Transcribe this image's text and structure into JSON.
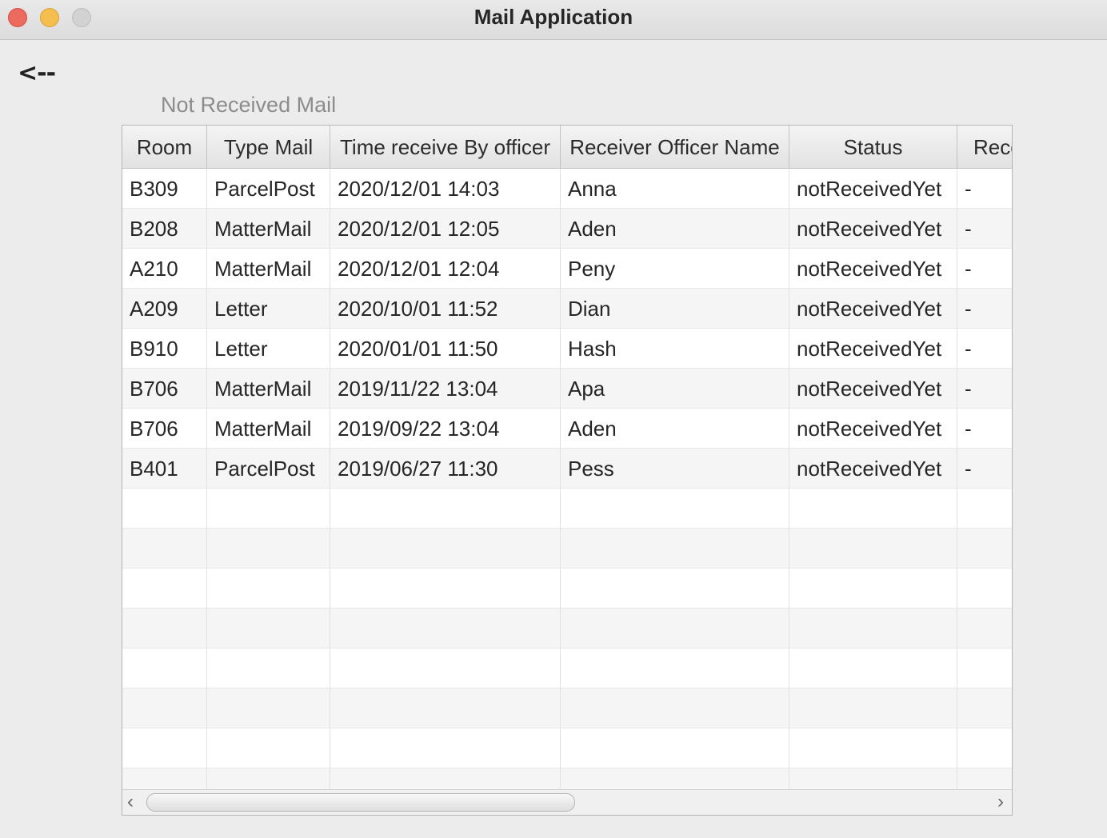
{
  "window": {
    "title": "Mail Application"
  },
  "back_label": "<--",
  "heading": "Not Received Mail",
  "table": {
    "columns": [
      "Room",
      "Type Mail",
      "Time receive By officer",
      "Receiver Officer Name",
      "Status",
      "Rece"
    ],
    "rows": [
      [
        "B309",
        "ParcelPost",
        "2020/12/01 14:03",
        "Anna",
        "notReceivedYet",
        "-"
      ],
      [
        "B208",
        "MatterMail",
        "2020/12/01 12:05",
        "Aden",
        "notReceivedYet",
        "-"
      ],
      [
        "A210",
        "MatterMail",
        "2020/12/01 12:04",
        "Peny",
        "notReceivedYet",
        "-"
      ],
      [
        "A209",
        "Letter",
        "2020/10/01 11:52",
        "Dian",
        "notReceivedYet",
        "-"
      ],
      [
        "B910",
        "Letter",
        "2020/01/01 11:50",
        "Hash",
        "notReceivedYet",
        "-"
      ],
      [
        "B706",
        "MatterMail",
        "2019/11/22 13:04",
        "Apa",
        "notReceivedYet",
        "-"
      ],
      [
        "B706",
        "MatterMail",
        "2019/09/22 13:04",
        "Aden",
        "notReceivedYet",
        "-"
      ],
      [
        "B401",
        "ParcelPost",
        "2019/06/27 11:30",
        "Pess",
        "notReceivedYet",
        "-"
      ]
    ]
  },
  "scrollbar": {
    "left_icon": "chevron-left-icon",
    "right_icon": "chevron-right-icon"
  }
}
